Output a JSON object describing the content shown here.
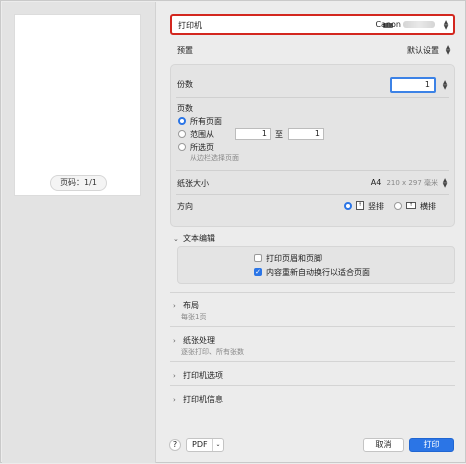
{
  "preview": {
    "page_indicator": "页码：1/1"
  },
  "printer": {
    "label": "打印机",
    "name": "Canon"
  },
  "preset": {
    "label": "预置",
    "value": "默认设置"
  },
  "copies": {
    "label": "份数",
    "value": "1"
  },
  "pages": {
    "label": "页数",
    "all_label": "所有页面",
    "range_label": "范围从",
    "range_from": "1",
    "range_to_label": "至",
    "range_to": "1",
    "selected_label": "所选页",
    "selected_hint": "从边栏选择页面",
    "selected_option": "all"
  },
  "paper_size": {
    "label": "纸张大小",
    "value": "A4",
    "dimensions": "210 x 297 毫米"
  },
  "orientation": {
    "label": "方向",
    "portrait_label": "竖排",
    "landscape_label": "横排",
    "selected": "portrait"
  },
  "sections": {
    "text_edit": {
      "label": "文本编辑",
      "print_header_footer": "打印页眉和页脚",
      "print_header_footer_checked": false,
      "rewrap": "内容重新自动换行以适合页面",
      "rewrap_checked": true
    },
    "layout": {
      "label": "布局",
      "summary": "每张1页"
    },
    "paper_handling": {
      "label": "纸张处理",
      "summary": "逐张打印、所有张数"
    },
    "printer_options": {
      "label": "打印机选项"
    },
    "printer_info": {
      "label": "打印机信息"
    }
  },
  "footer": {
    "help_label": "?",
    "pdf_label": "PDF",
    "cancel_label": "取消",
    "print_label": "打印"
  },
  "colors": {
    "accent": "#2b75e6",
    "highlight_border": "#d3271f"
  }
}
